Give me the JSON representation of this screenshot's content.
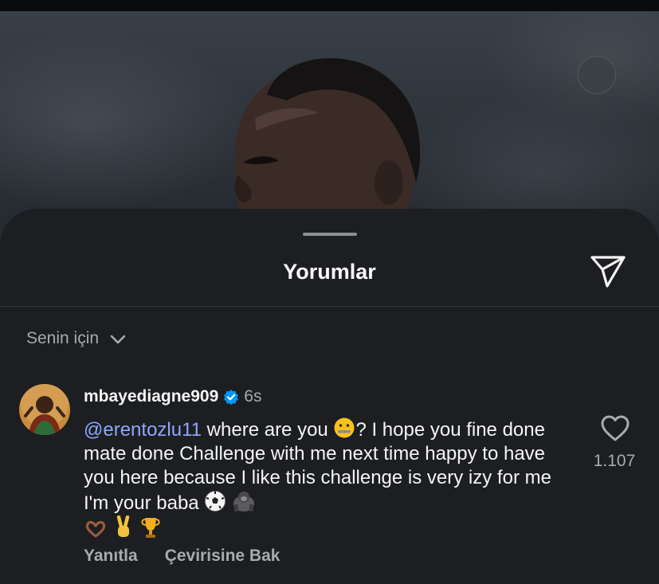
{
  "sheet": {
    "title": "Yorumlar",
    "filter_label": "Senin için"
  },
  "comment": {
    "username": "mbayediagne909",
    "verified": true,
    "time": "6s",
    "mention": "@erentozlu11",
    "text_1": " where are you ",
    "text_2": "? I hope you fine done mate done Challenge with me next time happy to have you here because I like this challenge is very izy for me I'm your  baba ",
    "emojis": [
      "zipper-mouth-face",
      "soccer-ball",
      "gorilla",
      "heart-hands",
      "victory-hand",
      "trophy"
    ],
    "like_count": "1.107",
    "reply_label": "Yanıtla",
    "translate_label": "Çevirisine Bak"
  },
  "colors": {
    "background": "#1c1e21",
    "mention": "#8ea8ff",
    "verified": "#0095f6",
    "secondary_text": "#a8aaae"
  }
}
